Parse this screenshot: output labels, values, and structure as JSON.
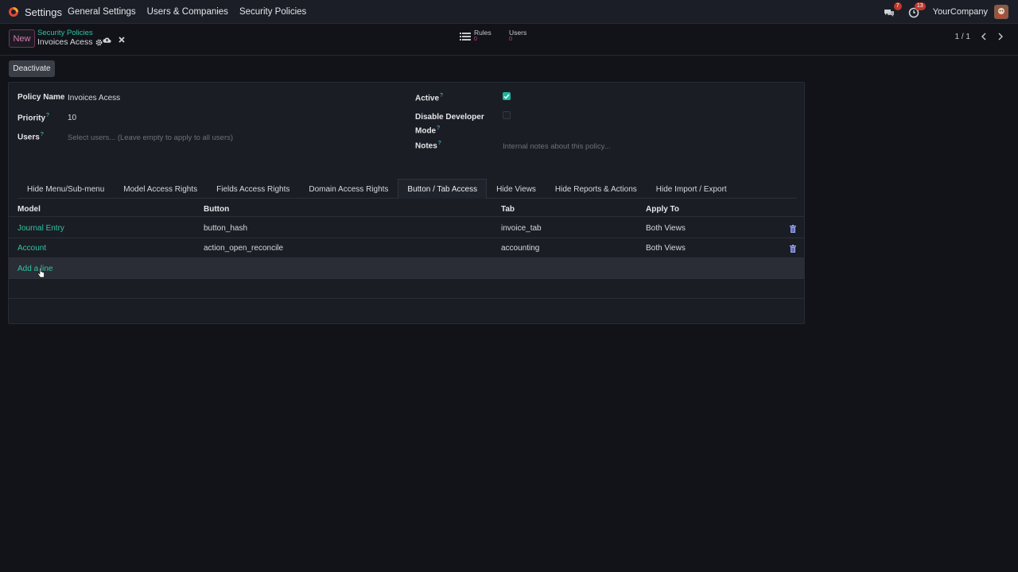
{
  "navbar": {
    "app_name": "Settings",
    "menu": [
      "General Settings",
      "Users & Companies",
      "Security Policies"
    ],
    "messages_count": "7",
    "activities_count": "13",
    "company": "YourCompany"
  },
  "control_panel": {
    "new_label": "New",
    "breadcrumb_parent": "Security Policies",
    "breadcrumb_current": "Invoices Acess",
    "smart_buttons": [
      {
        "label": "Rules",
        "value": "0"
      },
      {
        "label": "Users",
        "value": "0"
      }
    ],
    "pager": "1 / 1"
  },
  "actions": {
    "deactivate_label": "Deactivate"
  },
  "form": {
    "policy_name_label": "Policy Name",
    "policy_name_value": "Invoices Acess",
    "priority_label": "Priority",
    "priority_value": "10",
    "users_label": "Users",
    "users_placeholder": "Select users... (Leave empty to apply to all users)",
    "active_label": "Active",
    "active_checked": true,
    "disable_dev_label_1": "Disable Developer",
    "disable_dev_label_2": "Mode",
    "disable_dev_checked": false,
    "notes_label": "Notes",
    "notes_placeholder": "Internal notes about this policy...",
    "help_mark": "?"
  },
  "tabs": [
    {
      "label": "Hide Menu/Sub-menu",
      "active": false
    },
    {
      "label": "Model Access Rights",
      "active": false
    },
    {
      "label": "Fields Access Rights",
      "active": false
    },
    {
      "label": "Domain Access Rights",
      "active": false
    },
    {
      "label": "Button / Tab Access",
      "active": true
    },
    {
      "label": "Hide Views",
      "active": false
    },
    {
      "label": "Hide Reports & Actions",
      "active": false
    },
    {
      "label": "Hide Import / Export",
      "active": false
    }
  ],
  "table": {
    "columns": [
      "Model",
      "Button",
      "Tab",
      "Apply To"
    ],
    "rows": [
      {
        "model": "Journal Entry",
        "button": "button_hash",
        "tab": "invoice_tab",
        "apply_to": "Both Views"
      },
      {
        "model": "Account",
        "button": "action_open_reconcile",
        "tab": "accounting",
        "apply_to": "Both Views"
      }
    ],
    "add_line_label": "Add a line"
  },
  "colors": {
    "accent_teal": "#2fc4a4",
    "accent_pink": "#d77fae",
    "background": "#111319"
  }
}
